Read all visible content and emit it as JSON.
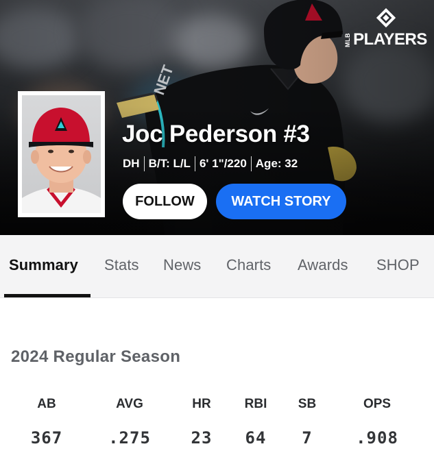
{
  "brand": {
    "league_tag": "MLB",
    "wordmark": "PLAYERS",
    "icon": "mlb-players-logo-icon"
  },
  "player": {
    "name_line": "Joc Pederson #3",
    "meta": [
      "DH",
      "B/T: L/L",
      "6' 1\"/220",
      "Age: 32"
    ],
    "headshot_icon": "player-headshot"
  },
  "actions": {
    "follow_label": "FOLLOW",
    "watch_story_label": "WATCH STORY"
  },
  "tabs": [
    {
      "label": "Summary",
      "active": true
    },
    {
      "label": "Stats",
      "active": false
    },
    {
      "label": "News",
      "active": false
    },
    {
      "label": "Charts",
      "active": false
    },
    {
      "label": "Awards",
      "active": false
    },
    {
      "label": "SHOP",
      "active": false
    }
  ],
  "season": {
    "title": "2024 Regular Season",
    "columns": [
      "AB",
      "AVG",
      "HR",
      "RBI",
      "SB",
      "OPS"
    ],
    "values": [
      "367",
      ".275",
      "23",
      "64",
      "7",
      ".908"
    ]
  },
  "colors": {
    "accent_blue": "#1a6ff3",
    "team_red": "#c8102e",
    "team_black": "#0b0b0c",
    "team_teal": "#30ced8"
  }
}
